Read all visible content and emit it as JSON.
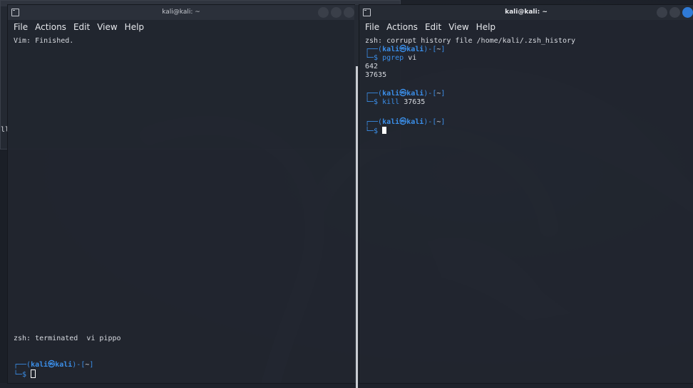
{
  "background_window": {
    "fragment_text": "ll"
  },
  "left_terminal": {
    "title": "kali@kali: ~",
    "menu": [
      "File",
      "Actions",
      "Edit",
      "View",
      "Help"
    ],
    "status_line": "Vim: Finished.",
    "terminated_line": "zsh: terminated  vi pippo",
    "prompt": {
      "user": "kali",
      "host": "kali",
      "dir": "~"
    }
  },
  "right_terminal": {
    "title": "kali@kali: ~",
    "menu": [
      "File",
      "Actions",
      "Edit",
      "View",
      "Help"
    ],
    "warning": "zsh: corrupt history file /home/kali/.zsh_history",
    "prompt": {
      "user": "kali",
      "host": "kali",
      "dir": "~"
    },
    "commands": [
      {
        "cmd": "pgrep",
        "arg": "vi",
        "output": [
          "642",
          "37635"
        ]
      },
      {
        "cmd": "kill",
        "arg": "37635",
        "output": []
      }
    ]
  },
  "colors": {
    "prompt_blue": "#3b8ee8",
    "accent": "#2f7ad6",
    "terminal_bg": "#21262f"
  }
}
